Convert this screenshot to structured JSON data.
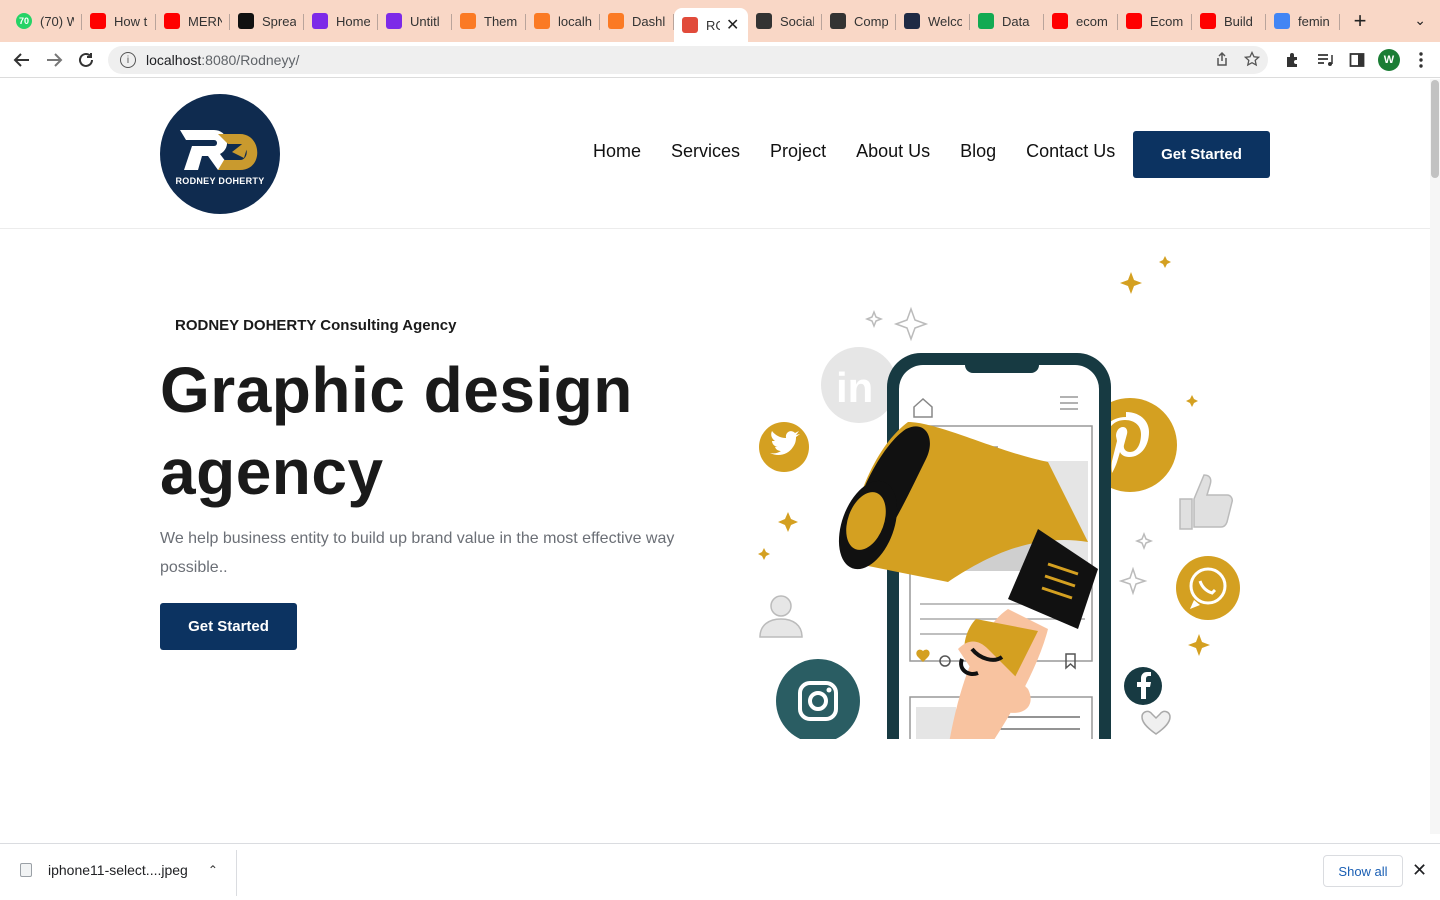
{
  "browser": {
    "tabs": [
      {
        "title": "(70) W",
        "icon": "whatsapp-icon",
        "color": "#25d366",
        "badge": "70"
      },
      {
        "title": "How t",
        "icon": "youtube-icon",
        "color": "#ff0000"
      },
      {
        "title": "MERN",
        "icon": "youtube-icon",
        "color": "#ff0000"
      },
      {
        "title": "Sprea",
        "icon": "m-logo-icon",
        "color": "#111111"
      },
      {
        "title": "Home",
        "icon": "canva-icon",
        "color": "#7d2ae8"
      },
      {
        "title": "Untitl",
        "icon": "canva-icon",
        "color": "#7d2ae8"
      },
      {
        "title": "Them",
        "icon": "xampp-icon",
        "color": "#fb7a24"
      },
      {
        "title": "localh",
        "icon": "xampp-icon",
        "color": "#fb7a24"
      },
      {
        "title": "Dashl",
        "icon": "xampp-icon",
        "color": "#fb7a24"
      },
      {
        "title": "RC",
        "icon": "site-icon",
        "color": "#e14b3b",
        "active": true
      },
      {
        "title": "Social",
        "icon": "globe-icon",
        "color": "#333333"
      },
      {
        "title": "Comp",
        "icon": "globe-icon",
        "color": "#333333"
      },
      {
        "title": "Welco",
        "icon": "react-icon",
        "color": "#1f2a44"
      },
      {
        "title": "Data",
        "icon": "mongodb-icon",
        "color": "#13aa52"
      },
      {
        "title": "ecom",
        "icon": "youtube-icon",
        "color": "#ff0000"
      },
      {
        "title": "Ecom",
        "icon": "youtube-icon",
        "color": "#ff0000"
      },
      {
        "title": "Build",
        "icon": "youtube-icon",
        "color": "#ff0000"
      },
      {
        "title": "femin",
        "icon": "google-icon",
        "color": "#4285f4"
      }
    ],
    "url_host": "localhost",
    "url_path": ":8080/Rodneyy/",
    "profile_initial": "W"
  },
  "site": {
    "logo_text": "RODNEY DOHERTY",
    "logo_mark": "RD",
    "nav": [
      "Home",
      "Services",
      "Project",
      "About Us",
      "Blog",
      "Contact Us"
    ],
    "header_cta": "Get Started"
  },
  "hero": {
    "eyebrow": "RODNEY DOHERTY Consulting Agency",
    "title": "Graphic design agency",
    "description": "We help business entity to build up brand value in the most effective way possible..",
    "cta": "Get Started"
  },
  "colors": {
    "brand_navy": "#0c3361",
    "accent_gold": "#d4a021",
    "teal_dark": "#173a42"
  },
  "downloads": {
    "filename": "iphone11-select....jpeg",
    "show_all": "Show all"
  }
}
